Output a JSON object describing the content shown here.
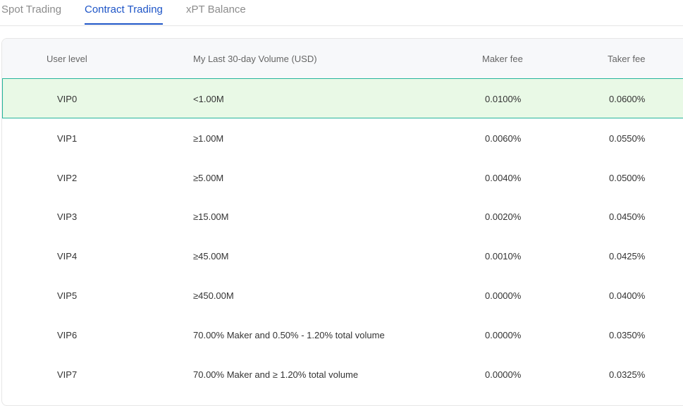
{
  "tabs": [
    {
      "label": "Spot Trading",
      "active": false
    },
    {
      "label": "Contract Trading",
      "active": true
    },
    {
      "label": "xPT Balance",
      "active": false
    }
  ],
  "table": {
    "headers": {
      "level": "User level",
      "volume": "My Last 30-day Volume (USD)",
      "maker": "Maker fee",
      "taker": "Taker fee"
    },
    "rows": [
      {
        "level": "VIP0",
        "volume": "<1.00M",
        "maker": "0.0100%",
        "taker": "0.0600%",
        "current": true
      },
      {
        "level": "VIP1",
        "volume": "≥1.00M",
        "maker": "0.0060%",
        "taker": "0.0550%"
      },
      {
        "level": "VIP2",
        "volume": "≥5.00M",
        "maker": "0.0040%",
        "taker": "0.0500%"
      },
      {
        "level": "VIP3",
        "volume": "≥15.00M",
        "maker": "0.0020%",
        "taker": "0.0450%"
      },
      {
        "level": "VIP4",
        "volume": "≥45.00M",
        "maker": "0.0010%",
        "taker": "0.0425%"
      },
      {
        "level": "VIP5",
        "volume": "≥450.00M",
        "maker": "0.0000%",
        "taker": "0.0400%"
      },
      {
        "level": "VIP6",
        "volume": "70.00% Maker and 0.50% - 1.20% total volume",
        "maker": "0.0000%",
        "taker": "0.0350%"
      },
      {
        "level": "VIP7",
        "volume": "70.00% Maker and ≥ 1.20% total volume",
        "maker": "0.0000%",
        "taker": "0.0325%"
      }
    ]
  },
  "colors": {
    "accent": "#1e55c7",
    "current_row_bg": "#e9f9e6",
    "current_row_border": "#27b59c"
  }
}
